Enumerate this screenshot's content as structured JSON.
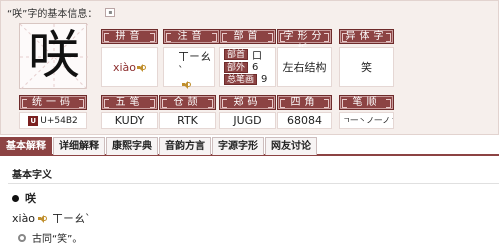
{
  "header": {
    "title": "“咲”字的基本信息：",
    "print_icon": "print-icon"
  },
  "character": "咲",
  "fields": {
    "pinyin": {
      "label": "拼音",
      "value": "xiào"
    },
    "zhuyin": {
      "label": "注音",
      "value": "ㄒㄧㄠˋ"
    },
    "bushou": {
      "label": "部首",
      "bushou_tag": "部首",
      "bushou_value": "口",
      "bubihua_tag": "部外",
      "bubihua_value": "6",
      "zongbihua_tag": "总笔画",
      "zongbihua_value": "9"
    },
    "structure": {
      "label": "字形分析",
      "value": "左右结构"
    },
    "variant": {
      "label": "异体字",
      "value": "笑"
    },
    "unicode": {
      "label": "统一码",
      "value": "U+54B2"
    },
    "wubi": {
      "label": "五笔",
      "value": "KUDY"
    },
    "cangjie": {
      "label": "仓颉",
      "value": "RTK"
    },
    "zhengma": {
      "label": "郑码",
      "value": "JUGD"
    },
    "sijiao": {
      "label": "四角",
      "value": "68084"
    },
    "bishun": {
      "label": "笔顺",
      "value": "丨ㄱ一丶ノ一ノ丶"
    }
  },
  "tabs": [
    {
      "label": "基本解释",
      "active": true
    },
    {
      "label": "详细解释",
      "active": false
    },
    {
      "label": "康熙字典",
      "active": false
    },
    {
      "label": "音韵方言",
      "active": false
    },
    {
      "label": "字源字形",
      "active": false
    },
    {
      "label": "网友讨论",
      "active": false
    }
  ],
  "basic": {
    "section_title": "基本字义",
    "entry_char": "咲",
    "pinyin": "xiào",
    "zhuyin": "ㄒㄧㄠˋ",
    "meaning": "古同“笑”。"
  },
  "colors": {
    "accent": "#8c4343",
    "panel_bg": "#f6efec",
    "speaker": "#c08f2d"
  }
}
